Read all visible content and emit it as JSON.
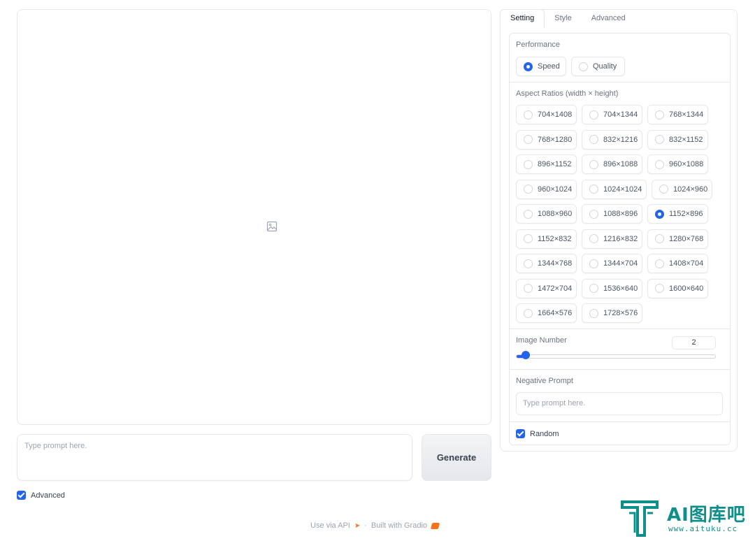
{
  "prompt": {
    "placeholder": "Type prompt here."
  },
  "generate_label": "Generate",
  "advanced": {
    "label": "Advanced",
    "checked": true
  },
  "footer": {
    "api_text": "Use via API",
    "separator": "·",
    "built_text": "Built with Gradio"
  },
  "tabs": [
    {
      "label": "Setting",
      "active": true
    },
    {
      "label": "Style",
      "active": false
    },
    {
      "label": "Advanced",
      "active": false
    }
  ],
  "performance": {
    "label": "Performance",
    "options": [
      {
        "label": "Speed",
        "selected": true
      },
      {
        "label": "Quality",
        "selected": false
      }
    ]
  },
  "aspect": {
    "label": "Aspect Ratios (width × height)",
    "selected": "1152×896",
    "options": [
      "704×1408",
      "704×1344",
      "768×1344",
      "768×1280",
      "832×1216",
      "832×1152",
      "896×1152",
      "896×1088",
      "960×1088",
      "960×1024",
      "1024×1024",
      "1024×960",
      "1088×960",
      "1088×896",
      "1152×896",
      "1152×832",
      "1216×832",
      "1280×768",
      "1344×768",
      "1344×704",
      "1408×704",
      "1472×704",
      "1536×640",
      "1600×640",
      "1664×576",
      "1728×576"
    ]
  },
  "image_number": {
    "label": "Image Number",
    "value": "2",
    "fraction": 0.05
  },
  "negative_prompt": {
    "label": "Negative Prompt",
    "placeholder": "Type prompt here."
  },
  "random": {
    "label": "Random",
    "checked": true
  },
  "watermark": {
    "text": "AI图库吧",
    "sub": "www.aituku.cc"
  },
  "colors": {
    "accent": "#2563eb",
    "watermark": "#0f8f8a"
  }
}
